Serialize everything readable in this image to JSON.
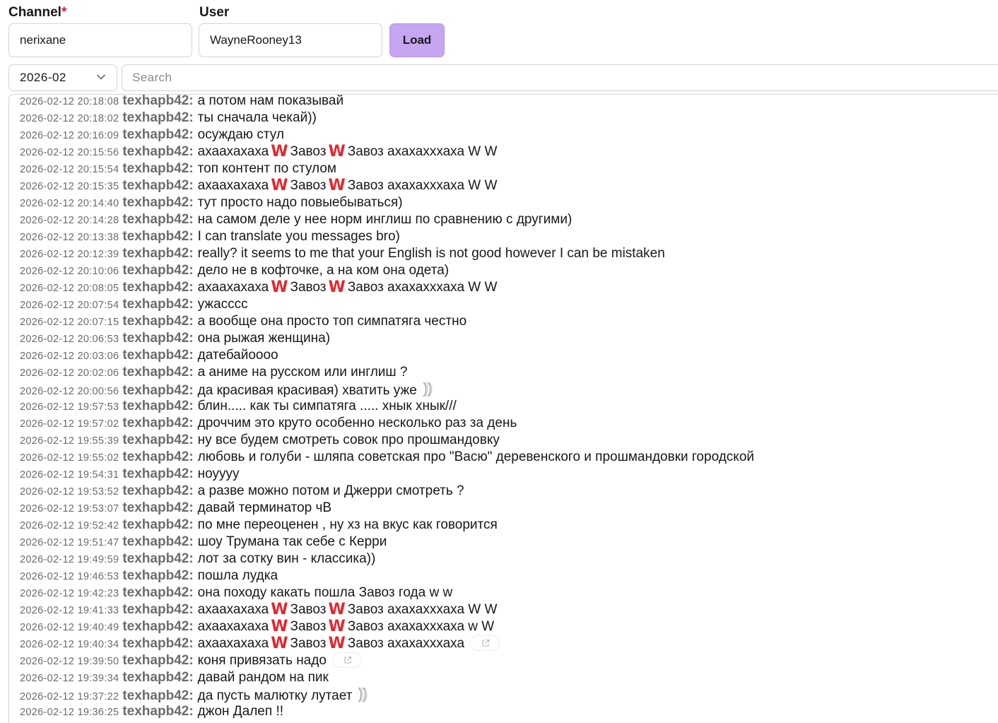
{
  "form": {
    "channel_label": "Channel",
    "channel_required_mark": "*",
    "channel_value": "nerixane",
    "user_label": "User",
    "user_value": "WayneRooney13",
    "load_label": "Load",
    "month_value": "2026-02",
    "search_placeholder": "Search"
  },
  "colors": {
    "accent_button": "#c4a6f1",
    "emote_red": "#e4262e",
    "username_gray": "#6b6b70"
  },
  "log": {
    "username": "texhapb42:",
    "messages": [
      {
        "time": "2026-02-12 20:18:08",
        "parts": [
          {
            "t": "text",
            "v": "а потом нам показывай"
          }
        ]
      },
      {
        "time": "2026-02-12 20:18:02",
        "parts": [
          {
            "t": "text",
            "v": "ты сначала чекай))"
          }
        ]
      },
      {
        "time": "2026-02-12 20:16:09",
        "parts": [
          {
            "t": "text",
            "v": "осуждаю стул"
          }
        ]
      },
      {
        "time": "2026-02-12 20:15:56",
        "parts": [
          {
            "t": "text",
            "v": "ахаахахаха"
          },
          {
            "t": "w",
            "v": "W"
          },
          {
            "t": "text",
            "v": "Завоз"
          },
          {
            "t": "w",
            "v": "W"
          },
          {
            "t": "text",
            "v": "Завоз ахахахххаха W W"
          }
        ]
      },
      {
        "time": "2026-02-12 20:15:54",
        "parts": [
          {
            "t": "text",
            "v": "топ контент по стулом"
          }
        ]
      },
      {
        "time": "2026-02-12 20:15:35",
        "parts": [
          {
            "t": "text",
            "v": "ахаахахаха"
          },
          {
            "t": "w",
            "v": "W"
          },
          {
            "t": "text",
            "v": "Завоз"
          },
          {
            "t": "w",
            "v": "W"
          },
          {
            "t": "text",
            "v": "Завоз ахахахххаха W W"
          }
        ]
      },
      {
        "time": "2026-02-12 20:14:40",
        "parts": [
          {
            "t": "text",
            "v": "тут просто надо повыебываться)"
          }
        ]
      },
      {
        "time": "2026-02-12 20:14:28",
        "parts": [
          {
            "t": "text",
            "v": "на самом деле у нее норм инглиш по сравнению с другими)"
          }
        ]
      },
      {
        "time": "2026-02-12 20:13:38",
        "parts": [
          {
            "t": "text",
            "v": "I can translate you messages bro)"
          }
        ]
      },
      {
        "time": "2026-02-12 20:12:39",
        "parts": [
          {
            "t": "text",
            "v": "really? it seems to me that your English is not good however I can be mistaken"
          }
        ]
      },
      {
        "time": "2026-02-12 20:10:06",
        "parts": [
          {
            "t": "text",
            "v": "дело не в кофточке, а на ком она одета)"
          }
        ]
      },
      {
        "time": "2026-02-12 20:08:05",
        "parts": [
          {
            "t": "text",
            "v": "ахаахахаха"
          },
          {
            "t": "w",
            "v": "W"
          },
          {
            "t": "text",
            "v": "Завоз"
          },
          {
            "t": "w",
            "v": "W"
          },
          {
            "t": "text",
            "v": "Завоз ахахахххаха W W"
          }
        ]
      },
      {
        "time": "2026-02-12 20:07:54",
        "parts": [
          {
            "t": "text",
            "v": "ужасссс"
          }
        ]
      },
      {
        "time": "2026-02-12 20:07:15",
        "parts": [
          {
            "t": "text",
            "v": "а вообще она просто топ симпатяга честно"
          }
        ]
      },
      {
        "time": "2026-02-12 20:06:53",
        "parts": [
          {
            "t": "text",
            "v": "она рыжая женщина)"
          }
        ]
      },
      {
        "time": "2026-02-12 20:03:06",
        "parts": [
          {
            "t": "text",
            "v": "датебайоооо"
          }
        ]
      },
      {
        "time": "2026-02-12 20:02:06",
        "parts": [
          {
            "t": "text",
            "v": "а аниме на русском или инглиш ?"
          }
        ]
      },
      {
        "time": "2026-02-12 20:00:56",
        "parts": [
          {
            "t": "text",
            "v": "да красивая красивая) хватить уже"
          },
          {
            "t": "twitch",
            "v": ""
          }
        ]
      },
      {
        "time": "2026-02-12 19:57:53",
        "parts": [
          {
            "t": "text",
            "v": "блин..... как ты симпатяга ..... хнык хнык///"
          }
        ]
      },
      {
        "time": "2026-02-12 19:57:02",
        "parts": [
          {
            "t": "text",
            "v": "дроччим это круто особенно несколько раз за день"
          }
        ]
      },
      {
        "time": "2026-02-12 19:55:39",
        "parts": [
          {
            "t": "text",
            "v": "ну все будем смотреть совок про прошмандовку"
          }
        ]
      },
      {
        "time": "2026-02-12 19:55:02",
        "parts": [
          {
            "t": "text",
            "v": "любовь и голуби - шляпа советская про \"Васю\" деревенского и прошмандовки городской"
          }
        ]
      },
      {
        "time": "2026-02-12 19:54:31",
        "parts": [
          {
            "t": "text",
            "v": "ноуууу"
          }
        ]
      },
      {
        "time": "2026-02-12 19:53:52",
        "parts": [
          {
            "t": "text",
            "v": "а разве можно потом и Джерри смотреть ?"
          }
        ]
      },
      {
        "time": "2026-02-12 19:53:07",
        "parts": [
          {
            "t": "text",
            "v": "давай терминатор чВ"
          }
        ]
      },
      {
        "time": "2026-02-12 19:52:42",
        "parts": [
          {
            "t": "text",
            "v": "по мне переоценен , ну хз на вкус как говорится"
          }
        ]
      },
      {
        "time": "2026-02-12 19:51:47",
        "parts": [
          {
            "t": "text",
            "v": "шоу Трумана так себе с Керри"
          }
        ]
      },
      {
        "time": "2026-02-12 19:49:59",
        "parts": [
          {
            "t": "text",
            "v": "лот за сотку вин - классика))"
          }
        ]
      },
      {
        "time": "2026-02-12 19:46:53",
        "parts": [
          {
            "t": "text",
            "v": "пошла лудка"
          }
        ]
      },
      {
        "time": "2026-02-12 19:42:23",
        "parts": [
          {
            "t": "text",
            "v": "она походу какать пошла Завоз года w w"
          }
        ]
      },
      {
        "time": "2026-02-12 19:41:33",
        "parts": [
          {
            "t": "text",
            "v": "ахаахахаха"
          },
          {
            "t": "w",
            "v": "W"
          },
          {
            "t": "text",
            "v": "Завоз"
          },
          {
            "t": "w",
            "v": "W"
          },
          {
            "t": "text",
            "v": "Завоз ахахахххаха W W"
          }
        ]
      },
      {
        "time": "2026-02-12 19:40:49",
        "parts": [
          {
            "t": "text",
            "v": "ахаахахаха"
          },
          {
            "t": "w",
            "v": "W"
          },
          {
            "t": "text",
            "v": "Завоз"
          },
          {
            "t": "w",
            "v": "W"
          },
          {
            "t": "text",
            "v": "Завоз ахахахххаха w W"
          }
        ]
      },
      {
        "time": "2026-02-12 19:40:34",
        "parts": [
          {
            "t": "text",
            "v": "ахаахахаха"
          },
          {
            "t": "w",
            "v": "W"
          },
          {
            "t": "text",
            "v": "Завоз"
          },
          {
            "t": "w",
            "v": "W"
          },
          {
            "t": "text",
            "v": "Завоз ахахахххаха"
          },
          {
            "t": "link",
            "v": ""
          }
        ]
      },
      {
        "time": "2026-02-12 19:39:50",
        "parts": [
          {
            "t": "text",
            "v": "коня привязать надо"
          },
          {
            "t": "link",
            "v": ""
          }
        ]
      },
      {
        "time": "2026-02-12 19:39:34",
        "parts": [
          {
            "t": "text",
            "v": "давай рандом на пик"
          }
        ]
      },
      {
        "time": "2026-02-12 19:37:22",
        "parts": [
          {
            "t": "text",
            "v": "да пусть малютку лутает"
          },
          {
            "t": "twitch",
            "v": ""
          }
        ]
      },
      {
        "time": "2026-02-12 19:36:25",
        "parts": [
          {
            "t": "text",
            "v": "джон Далеп !!"
          }
        ]
      }
    ]
  }
}
